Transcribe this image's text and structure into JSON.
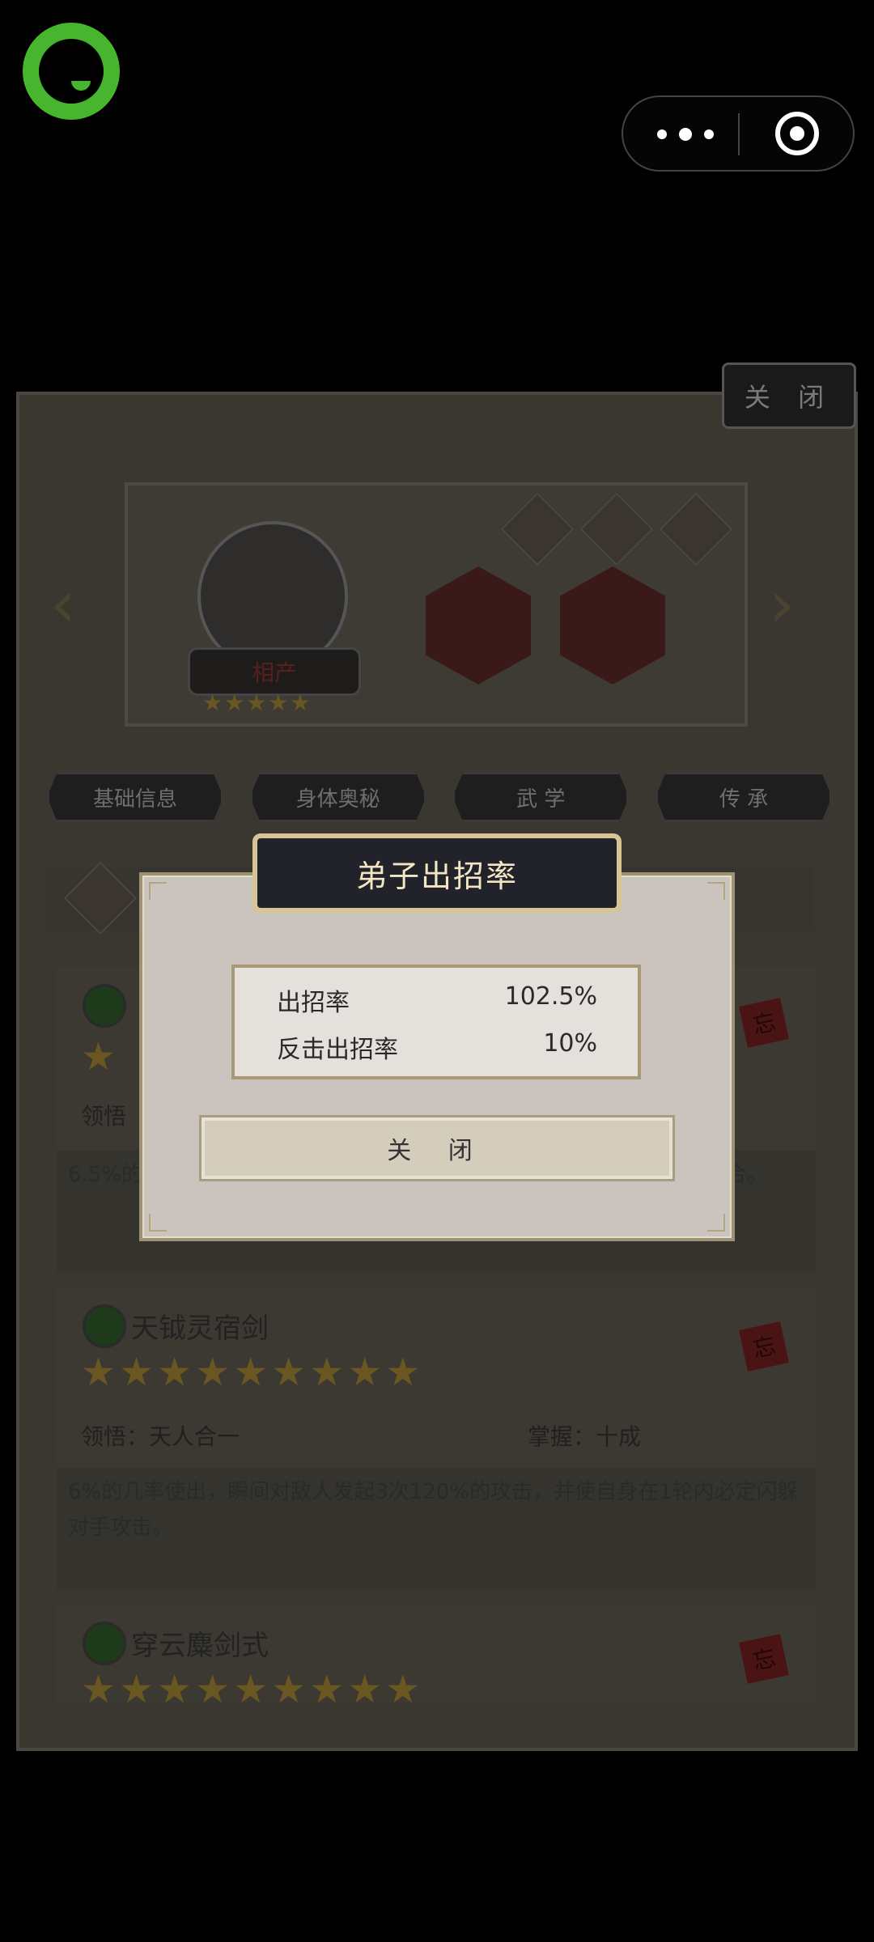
{
  "top_bar": {
    "logo_icon": "chat-bubble-logo",
    "more_icon": "more-dots-icon",
    "target_icon": "target-icon"
  },
  "panel": {
    "top_close_label": "关 闭",
    "hero": {
      "name": "相产",
      "stars": "★★★★★"
    },
    "tabs": [
      "基础信息",
      "身体奥秘",
      "武 学",
      "传 承"
    ]
  },
  "skills": [
    {
      "stars": "★",
      "level_label": "领悟",
      "desc": "6.5%的几率使出，对敌人造成连击伤害，使...（间隔1回合），持续2回合。",
      "seal": "忘"
    },
    {
      "name": "天钺灵宿剑",
      "stars": "★★★★★★★★★",
      "comprehension": "领悟：天人合一",
      "mastery": "掌握：十成",
      "desc": "6%的几率使出，瞬间对敌人发起3次120%的攻击，并使自身在1轮内必定闪躲对手攻击。",
      "seal": "忘"
    },
    {
      "name": "穿云麋剑式",
      "stars": "★★★★★★★★★",
      "seal": "忘"
    }
  ],
  "modal": {
    "title": "弟子出招率",
    "rows": [
      {
        "label": "出招率",
        "value": "102.5%"
      },
      {
        "label": "反击出招率",
        "value": "10%"
      }
    ],
    "close_label": "关 闭"
  }
}
